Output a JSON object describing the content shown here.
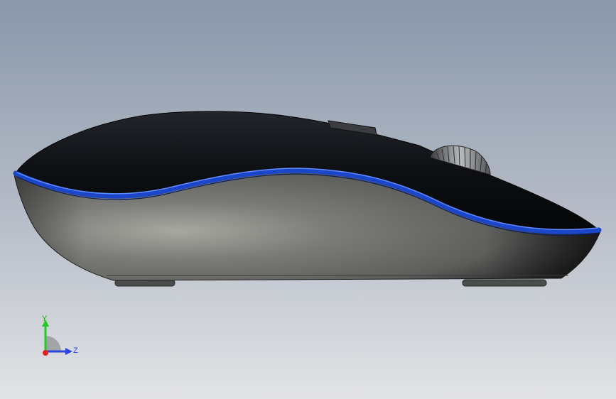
{
  "viewport": {
    "background_top": "#8a98ab",
    "background_bottom": "#dfe0e4"
  },
  "model": {
    "top_shell_color": "#0c0e12",
    "side_shell_color": "#6f706c",
    "accent_stripe_color": "#1f4fd6",
    "feet_color": "#4a4c4c"
  },
  "triad": {
    "y_label": "Y",
    "z_label": "Z",
    "y_color": "#22cc22",
    "z_color": "#2a45e0",
    "x_color": "#e02020"
  }
}
